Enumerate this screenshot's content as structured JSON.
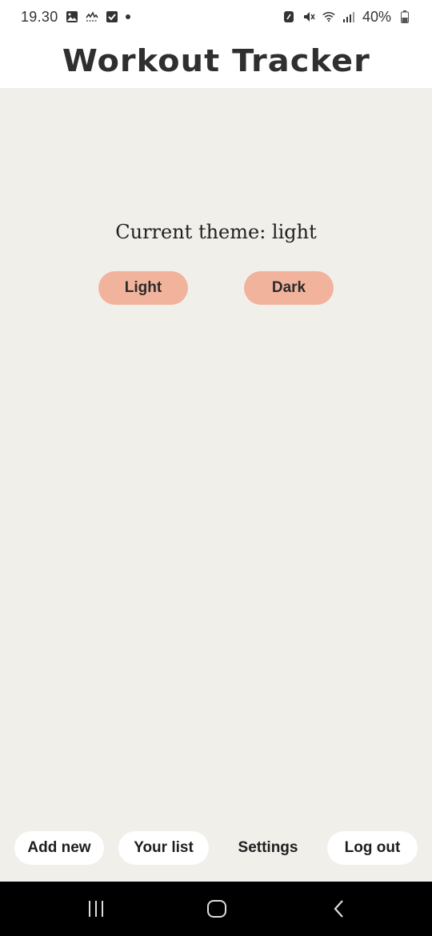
{
  "status_bar": {
    "time": "19.30",
    "battery": "40%",
    "left_icons": [
      "image-icon",
      "wave-icon",
      "checkbox-icon",
      "notification-dot-icon"
    ],
    "right_icons": [
      "nfc-icon",
      "mute-icon",
      "wifi-icon",
      "signal-icon",
      "battery-icon"
    ]
  },
  "header": {
    "title": "Workout Tracker"
  },
  "main": {
    "theme_label": "Current theme: light",
    "light_button": "Light",
    "dark_button": "Dark"
  },
  "bottom_nav": {
    "add_new": "Add new",
    "your_list": "Your list",
    "settings": "Settings",
    "log_out": "Log out"
  },
  "colors": {
    "background": "#f1efea",
    "accent": "#f2b39d",
    "header_bg": "#ffffff",
    "system_nav_bg": "#000000"
  }
}
